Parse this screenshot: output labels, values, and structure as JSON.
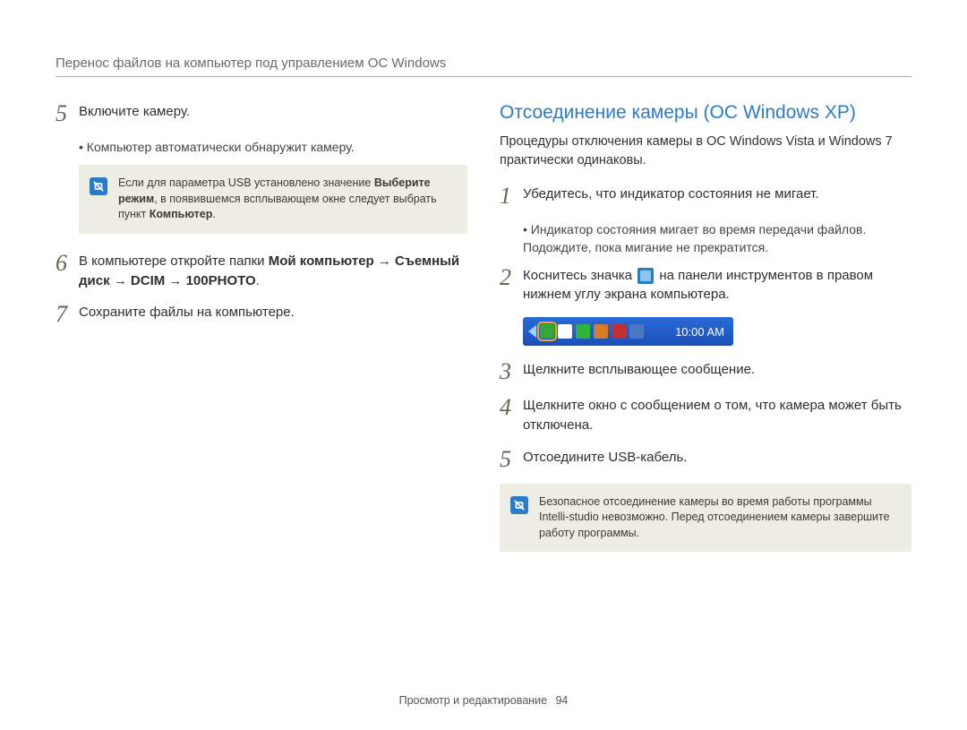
{
  "header": "Перенос файлов на компьютер под управлением ОС Windows",
  "left": {
    "step5": {
      "num": "5",
      "text": "Включите камеру."
    },
    "step5_sub": "Компьютер автоматически обнаружит камеру.",
    "note1_pre": "Если для параметра USB установлено значение ",
    "note1_b1": "Выберите режим",
    "note1_mid": ", в появившемся всплывающем окне следует выбрать пункт ",
    "note1_b2": "Компьютер",
    "note1_post": ".",
    "step6": {
      "num": "6",
      "pre": "В компьютере откройте папки ",
      "b": "Мой компьютер → Съемный диск → DCIM → 100PHOTO",
      "post": "."
    },
    "step7": {
      "num": "7",
      "text": "Сохраните файлы на компьютере."
    }
  },
  "right": {
    "heading": "Отсоединение камеры (ОС Windows XP)",
    "intro": "Процедуры отключения камеры в ОС Windows Vista и Windows 7 практически одинаковы.",
    "step1": {
      "num": "1",
      "text": "Убедитесь, что индикатор состояния не мигает."
    },
    "step1_sub": "Индикатор состояния мигает во время передачи файлов. Подождите, пока мигание не прекратится.",
    "step2": {
      "num": "2",
      "pre": "Коснитесь значка ",
      "post": " на панели инструментов в правом нижнем углу экрана компьютера."
    },
    "taskbar_time": "10:00 AM",
    "step3": {
      "num": "3",
      "text": "Щелкните всплывающее сообщение."
    },
    "step4": {
      "num": "4",
      "text": "Щелкните окно с сообщением о том, что камера может быть отключена."
    },
    "step5": {
      "num": "5",
      "text": "Отсоедините USB-кабель."
    },
    "note2": "Безопасное отсоединение камеры во время работы программы Intelli-studio невозможно. Перед отсоединением камеры завершите работу программы."
  },
  "footer": {
    "section": "Просмотр и редактирование",
    "page": "94"
  }
}
